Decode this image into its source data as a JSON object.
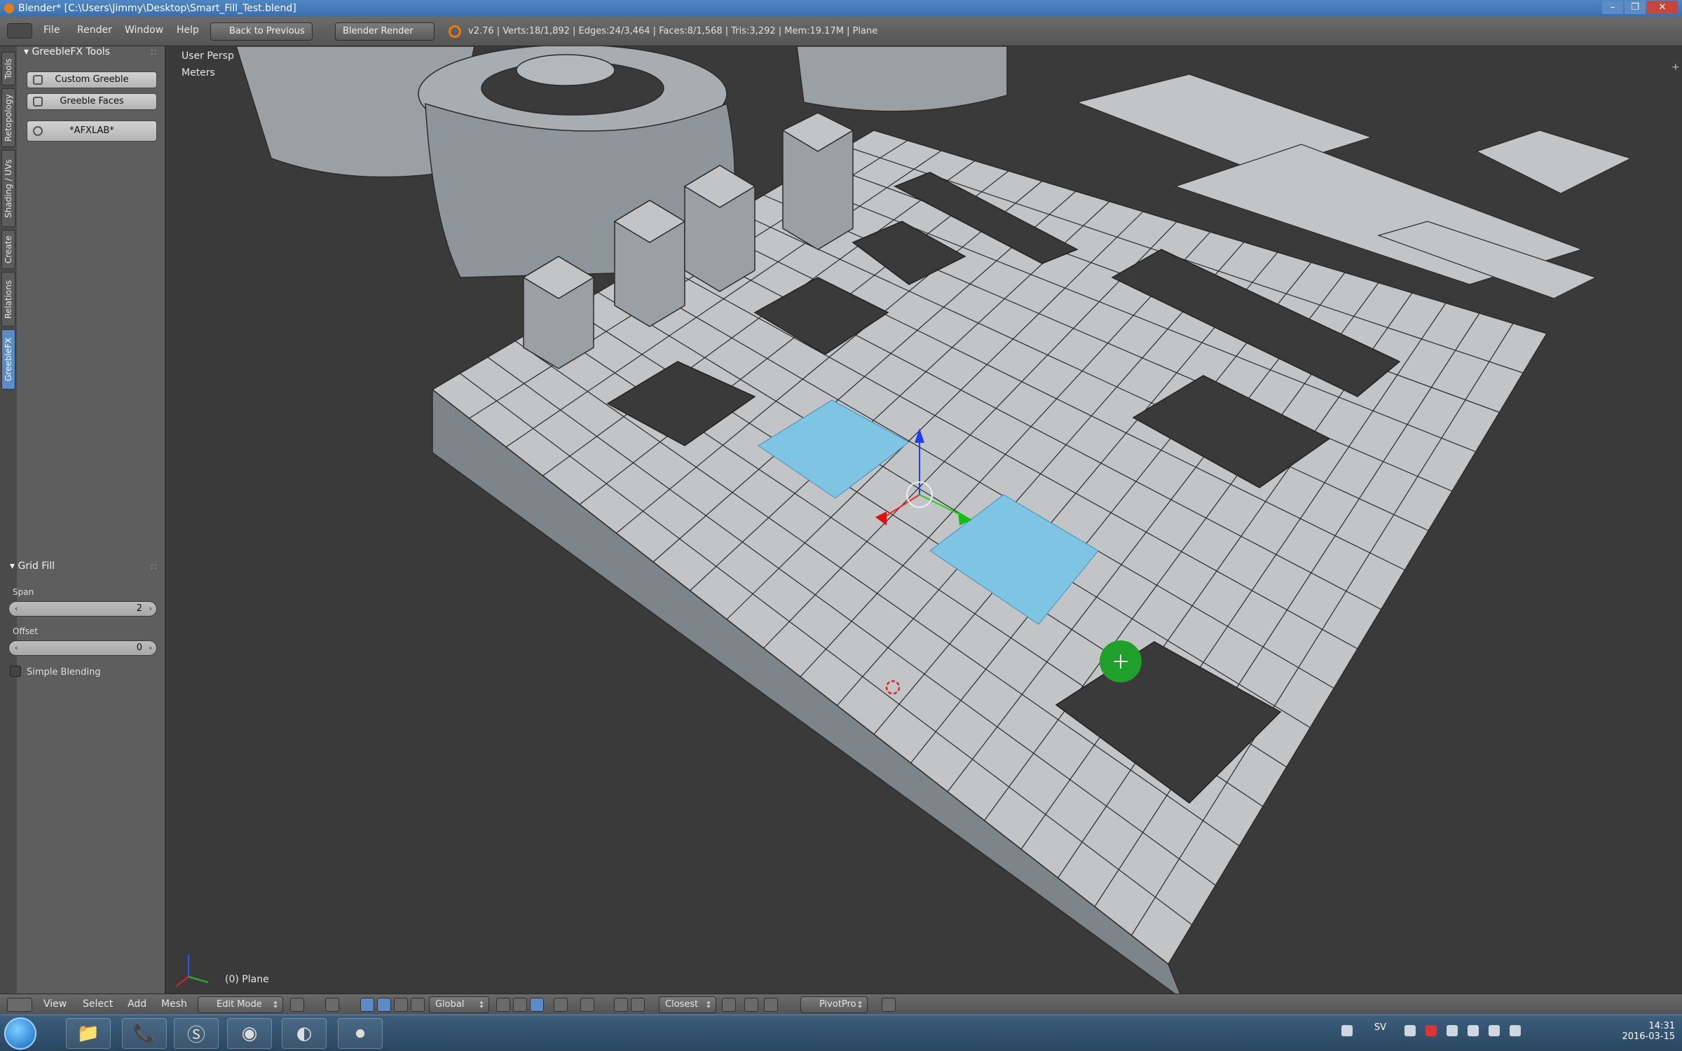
{
  "window": {
    "title": "Blender* [C:\\Users\\Jimmy\\Desktop\\Smart_Fill_Test.blend]",
    "controls": [
      "–",
      "❐",
      "✕"
    ]
  },
  "info_header": {
    "menus": [
      "File",
      "Render",
      "Window",
      "Help"
    ],
    "back_button": "Back to Previous",
    "render_engine": "Blender Render",
    "stats": "v2.76 | Verts:18/1,892 | Edges:24/3,464 | Faces:8/1,568 | Tris:3,292 | Mem:19.17M | Plane"
  },
  "toolshelf": {
    "tabs": [
      "Tools",
      "Retopology",
      "Shading / UVs",
      "Create",
      "Relations",
      "GreebleFX"
    ],
    "active_tab": "GreebleFX",
    "panel_title": "GreebleFX Tools",
    "buttons": [
      "Custom Greeble",
      "Greeble Faces",
      "*AFXLAB*"
    ],
    "grid_fill": {
      "title": "Grid Fill",
      "span_label": "Span",
      "span_value": "2",
      "offset_label": "Offset",
      "offset_value": "0",
      "simple_blending_label": "Simple Blending"
    }
  },
  "viewport": {
    "view_name": "User Persp",
    "units": "Meters",
    "object_label": "(0) Plane",
    "colors": {
      "background": "#3a3a3a",
      "face": "#c2c4c6",
      "selected_face": "#7ec4e3",
      "edge": "#2b2b2b",
      "side_face": "#8f969b",
      "cursor": "#1fa02a"
    }
  },
  "view_header": {
    "menus": [
      "View",
      "Select",
      "Add",
      "Mesh"
    ],
    "mode": "Edit Mode",
    "orientation": "Global",
    "snap_target": "Closest",
    "addon": "PivotPro"
  },
  "taskbar": {
    "apps": [
      "windows-orb",
      "file-explorer",
      "viber",
      "skype",
      "chrome",
      "blender",
      "recorder"
    ],
    "language": "SV",
    "time": "14:31",
    "date": "2016-03-15"
  }
}
